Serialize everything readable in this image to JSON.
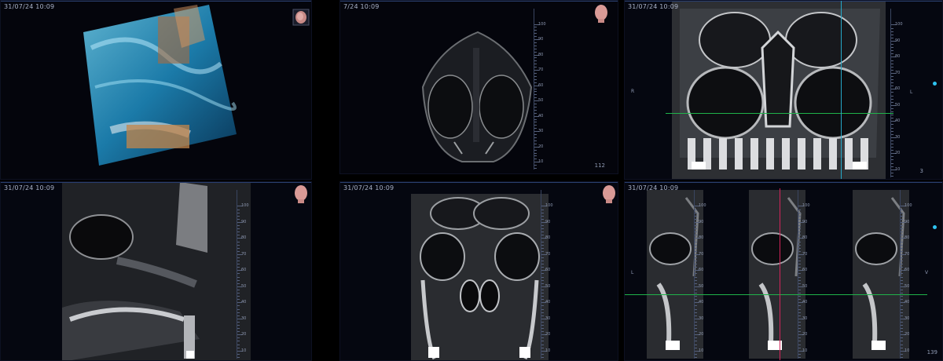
{
  "viewer": {
    "timestamp_full": "31/07/24 10:09",
    "timestamp_cut": "7/24 10:09",
    "colors": {
      "crosshair_green": "#1fb34a",
      "crosshair_cyan": "#26a9c9",
      "crosshair_red": "#d4245a",
      "accent_dot": "#2ec3f0",
      "ruler_text": "#8f9ab3"
    }
  },
  "panes": {
    "volume3d": {
      "stamp": "31/07/24 10:09",
      "icon": "volume-cube-icon"
    },
    "axial": {
      "stamp": "7/24 10:09",
      "icon": "head-icon",
      "slice": "112"
    },
    "coronal_top": {
      "stamp": "31/07/24 10:09",
      "slice": "3",
      "left_mark": "R",
      "right_mark": "L"
    },
    "sagittal": {
      "stamp": "31/07/24 10:09",
      "icon": "head-icon"
    },
    "coronal": {
      "stamp": "31/07/24 10:09",
      "icon": "head-icon"
    },
    "cross_sections": {
      "stamp": "31/07/24 10:09",
      "slice": "139",
      "left_mark": "L",
      "right_mark": "V"
    }
  },
  "ruler_labels": [
    "10",
    "20",
    "30",
    "40",
    "50",
    "60",
    "70",
    "80",
    "90",
    "100"
  ]
}
